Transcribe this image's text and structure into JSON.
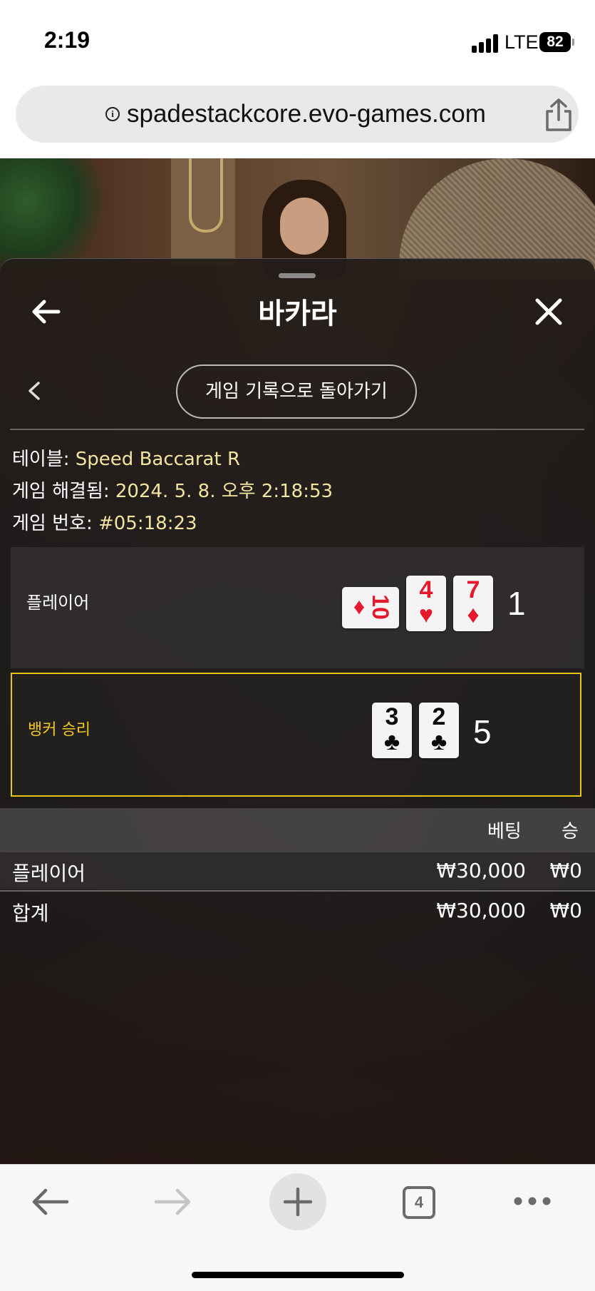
{
  "status_bar": {
    "time": "2:19",
    "network": "LTE",
    "battery": "82"
  },
  "browser": {
    "url": "spadestackcore.evo-games.com",
    "tab_count": "4"
  },
  "panel": {
    "title": "바카라",
    "back_to_history": "게임 기록으로 돌아가기",
    "info": {
      "table_label": "테이블: ",
      "table_value": "Speed Baccarat R",
      "resolved_label": "게임 해결됨: ",
      "resolved_value": "2024. 5. 8. 오후 2:18:53",
      "game_no_label": "게임 번호: ",
      "game_no_value": "#05:18:23"
    },
    "player": {
      "label": "플레이어",
      "score": "1",
      "cards": [
        {
          "rank": "10",
          "suit": "♦",
          "color": "red",
          "orientation": "horizontal"
        },
        {
          "rank": "4",
          "suit": "♥",
          "color": "red",
          "orientation": "vertical"
        },
        {
          "rank": "7",
          "suit": "♦",
          "color": "red",
          "orientation": "vertical"
        }
      ]
    },
    "banker": {
      "label": "뱅커 승리",
      "score": "5",
      "cards": [
        {
          "rank": "3",
          "suit": "♣",
          "color": "black",
          "orientation": "vertical"
        },
        {
          "rank": "2",
          "suit": "♣",
          "color": "black",
          "orientation": "vertical"
        }
      ]
    },
    "bets": {
      "col_bet": "베팅",
      "col_win": "승",
      "rows": [
        {
          "label": "플레이어",
          "bet": "₩30,000",
          "win": "₩0"
        }
      ],
      "total": {
        "label": "합계",
        "bet": "₩30,000",
        "win": "₩0"
      }
    }
  },
  "colors": {
    "winner_border": "#e7c51b",
    "info_value": "#f3e3a0"
  },
  "icons": [
    "info-icon",
    "share-icon",
    "back-arrow-icon",
    "close-icon",
    "chevron-left-icon",
    "nav-back-icon",
    "nav-forward-icon",
    "new-tab-plus-icon",
    "more-icon"
  ]
}
